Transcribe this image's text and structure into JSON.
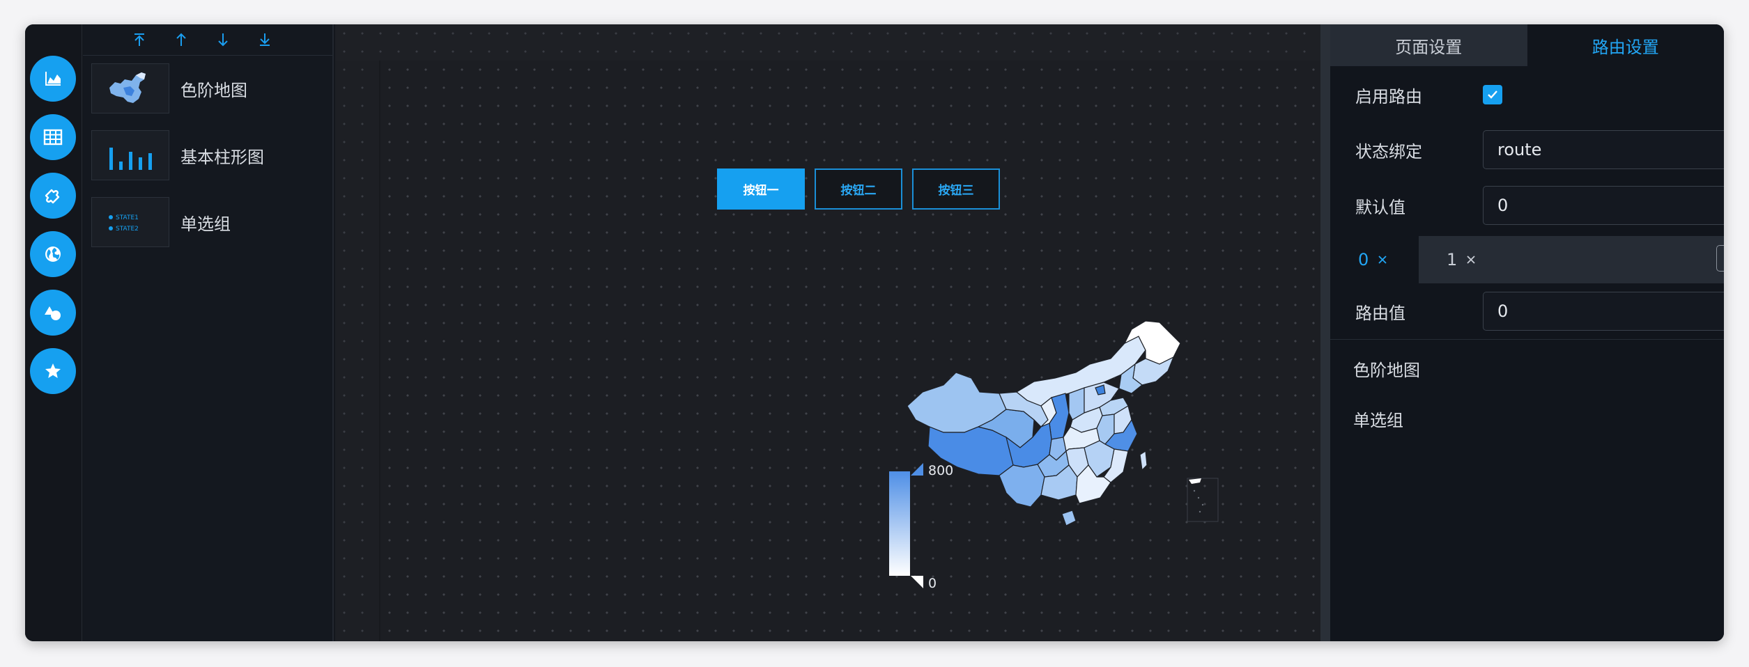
{
  "toolbar": {
    "icons": [
      "move-to-top-icon",
      "move-up-icon",
      "move-down-icon",
      "move-to-bottom-icon"
    ]
  },
  "rail": {
    "icons": [
      "area-chart-icon",
      "table-icon",
      "puzzle-icon",
      "globe-icon",
      "shapes-icon",
      "star-icon"
    ]
  },
  "components": [
    {
      "label": "色阶地图",
      "icon": "map-thumbnail"
    },
    {
      "label": "基本柱形图",
      "icon": "bar-chart-thumbnail"
    },
    {
      "label": "单选组",
      "icon": "radio-group-thumbnail",
      "thumb_lines": [
        "STATE1",
        "STATE2"
      ]
    }
  ],
  "canvas": {
    "buttons": [
      "按钮一",
      "按钮二",
      "按钮三"
    ],
    "active_button": 0,
    "legend": {
      "max": "800",
      "min": "0"
    }
  },
  "settings": {
    "tabs": [
      "页面设置",
      "路由设置"
    ],
    "active_tab": 1,
    "enable_route": {
      "label": "启用路由",
      "checked": true
    },
    "state_binding": {
      "label": "状态绑定",
      "value": "route"
    },
    "default_value": {
      "label": "默认值",
      "value": "0"
    },
    "route_tabs": [
      "0",
      "1"
    ],
    "active_route_tab": 0,
    "route_value": {
      "label": "路由值",
      "value": "0"
    },
    "bound_components": [
      "色阶地图",
      "单选组"
    ]
  },
  "colors": {
    "accent": "#16a0f0",
    "panel_bg": "#11151c",
    "canvas_bg": "#1c1e23"
  }
}
